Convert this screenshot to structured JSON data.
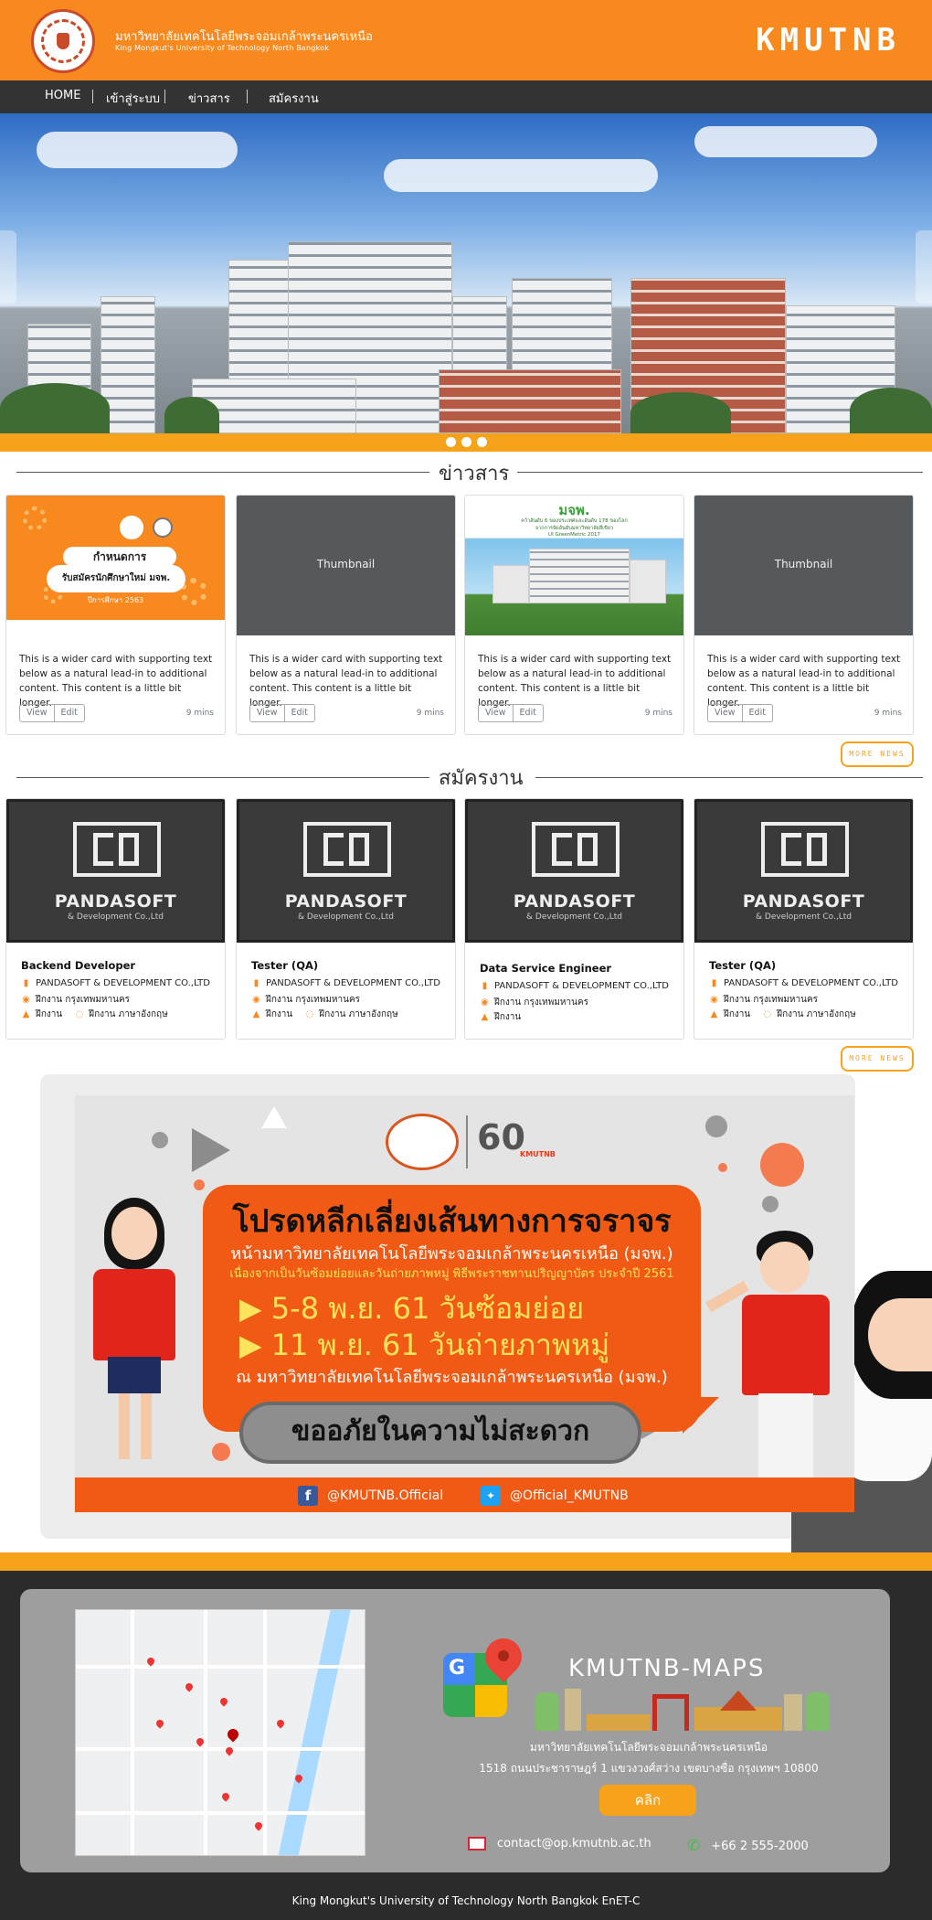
{
  "header": {
    "university_th": "มหาวิทยาลัยเทคโนโลยีพระจอมเกล้าพระนครเหนือ",
    "university_en": "King Mongkut's University of Technology North Bangkok",
    "brand": "KMUTNB"
  },
  "nav": [
    {
      "label": "HOME"
    },
    {
      "label": "เข้าสู่ระบบ"
    },
    {
      "label": "ข่าวสาร"
    },
    {
      "label": "สมัครงาน"
    }
  ],
  "carousel": {
    "slide_count": 3
  },
  "news": {
    "title": "ข่าวสาร",
    "more_label": "MORE NEWS",
    "cards": [
      {
        "image": "admission",
        "poster_title": "กำหนดการ",
        "poster_sub": "รับสมัครนักศึกษาใหม่ มจพ.",
        "poster_year": "ปีการศึกษา 2563",
        "text": "This is a wider card with supporting text below as a natural lead-in to additional content. This content is a little bit longer.",
        "view": "View",
        "edit": "Edit",
        "time": "9 mins"
      },
      {
        "image": "thumbnail",
        "thumb_label": "Thumbnail",
        "text": "This is a wider card with supporting text below as a natural lead-in to additional content. This content is a little bit longer.",
        "view": "View",
        "edit": "Edit",
        "time": "9 mins"
      },
      {
        "image": "campus",
        "poster_title": "มจพ.",
        "poster_sub": "คว้าอันดับ 6 ของประเทศและอันดับ 178 ของโลก",
        "poster_sub2": "จากการจัดอันดับมหาวิทยาลัยสีเขียว",
        "poster_sub3": "UI GreenMetric 2017",
        "text": "This is a wider card with supporting text below as a natural lead-in to additional content. This content is a little bit longer.",
        "view": "View",
        "edit": "Edit",
        "time": "9 mins"
      },
      {
        "image": "thumbnail",
        "thumb_label": "Thumbnail",
        "text": "This is a wider card with supporting text below as a natural lead-in to additional content. This content is a little bit longer.",
        "view": "View",
        "edit": "Edit",
        "time": "9 mins"
      }
    ]
  },
  "jobs": {
    "title": "สมัครงาน",
    "more_label": "MORE NEWS",
    "logo_name": "PANDASOFT",
    "logo_sub": "& Development Co.,Ltd",
    "cards": [
      {
        "title": "Backend Developer",
        "company": "PANDASOFT & DEVELOPMENT CO.,LTD",
        "location": "ฝึกงาน กรุงเทพมหานคร",
        "type": "ฝึกงาน",
        "lang": "ฝึกงาน ภาษาอังกฤษ"
      },
      {
        "title": "Tester (QA)",
        "company": "PANDASOFT & DEVELOPMENT CO.,LTD",
        "location": "ฝึกงาน กรุงเทพมหานคร",
        "type": "ฝึกงาน",
        "lang": "ฝึกงาน ภาษาอังกฤษ"
      },
      {
        "title": "Data Service Engineer",
        "company": "PANDASOFT & DEVELOPMENT CO.,LTD",
        "location": "ฝึกงาน กรุงเทพมหานคร",
        "type": "ฝึกงาน",
        "lang": ""
      },
      {
        "title": "Tester (QA)",
        "company": "PANDASOFT & DEVELOPMENT CO.,LTD",
        "location": "ฝึกงาน กรุงเทพมหานคร",
        "type": "ฝึกงาน",
        "lang": "ฝึกงาน ภาษาอังกฤษ"
      }
    ]
  },
  "banner": {
    "sixty": "60",
    "sixty_sub": "KMUTNB",
    "headline": "โปรดหลีกเลี่ยงเส้นทางการจราจร",
    "line1": "หน้ามหาวิทยาลัยเทคโนโลยีพระจอมเกล้าพระนครเหนือ (มจพ.)",
    "line2": "เนื่องจากเป็นวันซ้อมย่อยและวันถ่ายภาพหมู่ พิธีพระราชทานปริญญาบัตร ประจำปี 2561",
    "date1": "5-8  พ.ย. 61  วันซ้อมย่อย",
    "date2": "11   พ.ย. 61  วันถ่ายภาพหมู่",
    "line3": "ณ มหาวิทยาลัยเทคโนโลยีพระจอมเกล้าพระนครเหนือ (มจพ.)",
    "apology": "ขออภัยในความไม่สะดวก",
    "facebook": "@KMUTNB.Official",
    "twitter": "@Official_KMUTNB"
  },
  "footer": {
    "maps_title": "KMUTNB-MAPS",
    "address1": "มหาวิทยาลัยเทคโนโลยีพระจอมเกล้าพระนครเหนือ",
    "address2": "1518 ถนนประชาราษฎร์ 1 แขวงวงศ์สว่าง เขตบางซื่อ กรุงเทพฯ 10800",
    "click": "คลิก",
    "email": "contact@op.kmutnb.ac.th",
    "phone": "+66 2 555-2000",
    "copyright": "King Mongkut's University of Technology North Bangkok EnET-C"
  },
  "colors": {
    "brand_orange": "#f7891f",
    "accent_yellow": "#f7a21b",
    "nav_dark": "#333333",
    "footer_dark": "#2b2b2b"
  }
}
